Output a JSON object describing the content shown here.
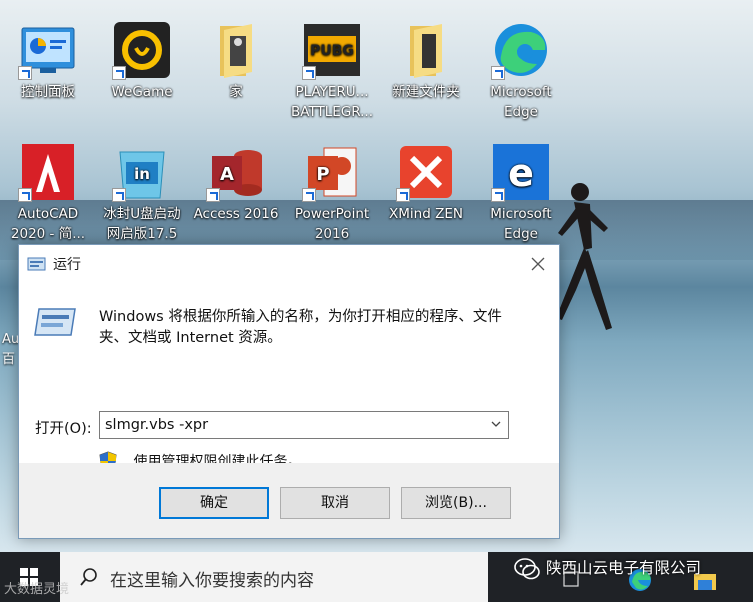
{
  "desktop": {
    "icons": [
      {
        "label": "控制面板"
      },
      {
        "label": "WeGame"
      },
      {
        "label": "家"
      },
      {
        "label": "PLAYERU...\nBATTLEGR..."
      },
      {
        "label": "新建文件夹"
      },
      {
        "label": "Microsoft\nEdge"
      },
      {
        "label": "AutoCAD\n2020 - 简..."
      },
      {
        "label": "冰封U盘启动\n网启版17.5"
      },
      {
        "label": "Access 2016"
      },
      {
        "label": "PowerPoint\n2016"
      },
      {
        "label": "XMind ZEN"
      },
      {
        "label": "Microsoft\nEdge"
      }
    ],
    "left_partial": "Au\n百"
  },
  "dialog": {
    "title": "运行",
    "description": "Windows 将根据你所输入的名称，为你打开相应的程序、文件夹、文档或 Internet 资源。",
    "open_label": "打开(O):",
    "input_value": "slmgr.vbs -xpr",
    "admin_note": "使用管理权限创建此任务。",
    "buttons": {
      "ok": "确定",
      "cancel": "取消",
      "browse": "浏览(B)..."
    }
  },
  "taskbar": {
    "search_placeholder": "在这里输入你要搜索的内容"
  },
  "watermark": {
    "text": "陕西山云电子有限公司",
    "corner_text": "大数据灵境"
  },
  "colors": {
    "accent": "#0078d7",
    "taskbar": "#1f2226",
    "dialog_footer": "#f0f0f0"
  }
}
